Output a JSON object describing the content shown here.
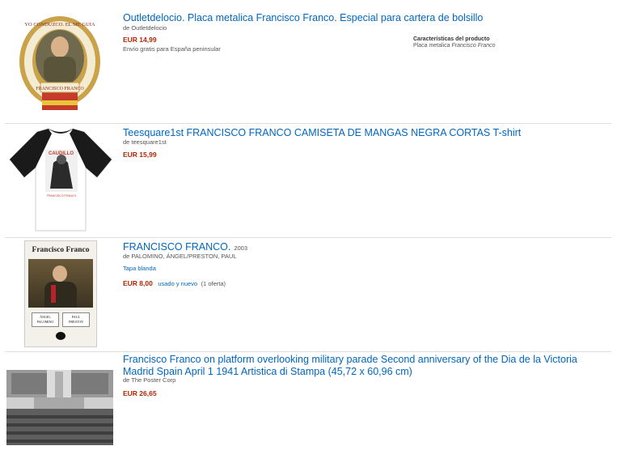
{
  "results": [
    {
      "title": "Outletdelocio. Placa metalica Francisco Franco. Especial para cartera de bolsillo",
      "byline": "de Outletdelocio",
      "price": "EUR 14,99",
      "shipping": "Envío gratis para España peninsular",
      "features_heading": "Características del producto",
      "features_text": "Placa metalica ",
      "features_em": "Francisco Franco",
      "image": {
        "ring_text_top": "YO CONDUZCO. EL ME GUIA",
        "banner_text": "FRANCISCO FRANCO"
      }
    },
    {
      "title": "Teesquare1st FRANCISCO FRANCO CAMISETA DE MANGAS NEGRA CORTAS T-shirt",
      "byline": "de teesquare1st",
      "price": "EUR 15,99",
      "image": {
        "print_text": "CAUDILLO",
        "print_caption": "FRANCISCO FRANCO"
      }
    },
    {
      "title": "FRANCISCO FRANCO.",
      "year": "2003",
      "byline": "de PALOMINO, ÁNGEL/PRESTON, PAUL",
      "format": "Tapa blanda",
      "price": "EUR 8,00",
      "offers_link": "usado y nuevo",
      "offers_count": "(1 oferta)",
      "image": {
        "cover_title": "Francisco Franco",
        "author1_line1": "ÁNGEL",
        "author1_line2": "PALOMINO",
        "author2_line1": "PAUL",
        "author2_line2": "PRESTON"
      }
    },
    {
      "title": "Francisco Franco on platform overlooking military parade Second anniversary of the Dia de la Victoria Madrid Spain April 1 1941 Artistica di Stampa (45,72 x 60,96 cm)",
      "byline": "de The Poster Corp",
      "price": "EUR 26,65"
    }
  ],
  "colors": {
    "link": "#0066c0",
    "price": "#b12704",
    "separator": "#dddddd"
  }
}
